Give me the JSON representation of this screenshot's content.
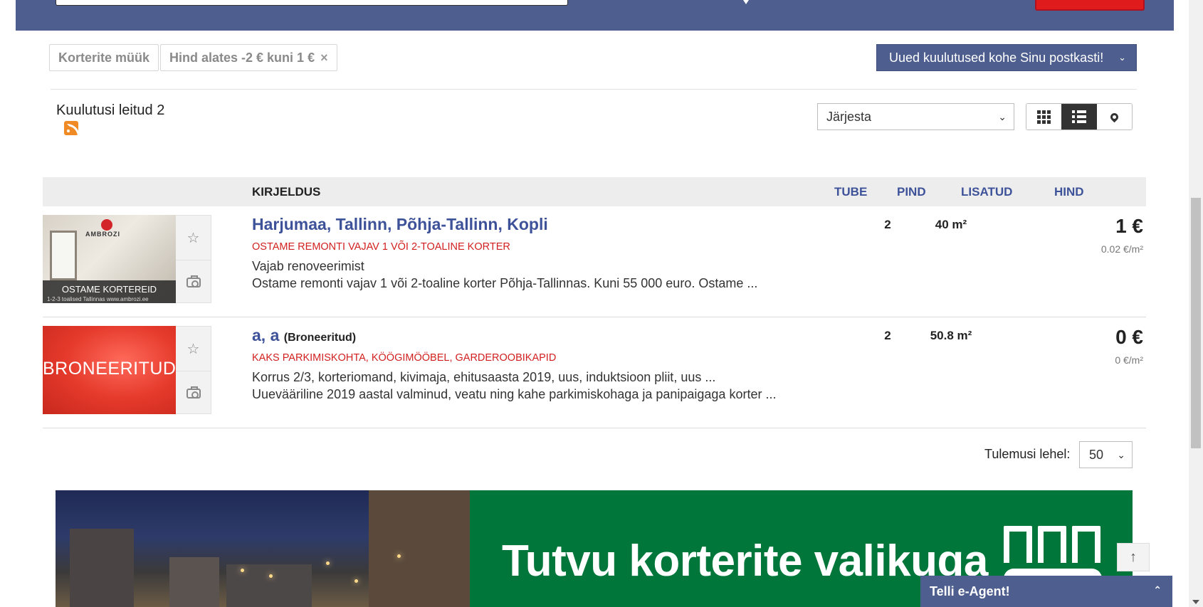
{
  "filters": {
    "chips": [
      {
        "label": "Korterite müük",
        "removable": false
      },
      {
        "label": "Hind alates -2 € kuni 1 €",
        "removable": true
      }
    ],
    "remove_icon": "×"
  },
  "email_alert": {
    "label": "Uued kuulutused kohe Sinu postkasti!",
    "chevron": "⌄"
  },
  "results": {
    "count_label": "Kuulutusi leitud 2",
    "sort": {
      "selected": "Järjesta"
    },
    "view_modes": [
      "grid-view-icon",
      "list-view-icon",
      "map-view-icon"
    ],
    "active_view": "list"
  },
  "table": {
    "headers": {
      "description": "KIRJELDUS",
      "rooms": "TUBE",
      "area": "PIND",
      "added": "LISATUD",
      "price": "HIND"
    }
  },
  "listings": [
    {
      "title": "Harjumaa, Tallinn, Põhja-Tallinn, Kopli",
      "status": "",
      "subtitle": "OSTAME REMONTI VAJAV 1 VÕI 2-TOALINE KORTER",
      "desc1": "Vajab renoveerimist",
      "desc2": "Ostame remonti vajav 1 või 2-toaline korter Põhja-Tallinnas. Kuni 55 000 euro. Ostame ...",
      "rooms": "2",
      "area": "40 m²",
      "added": "",
      "price": "1 €",
      "price_per_m2": "0.02 €/m²",
      "thumb_caption": "OSTAME KORTEREID",
      "thumb_small": "1-2-3 toalised Tallinnas     www.ambrozi.ee",
      "thumb_logo": "AMBROZI"
    },
    {
      "title": "a, a",
      "status": "(Broneeritud)",
      "subtitle": "KAKS PARKIMISKOHTA, KÖÖGIMÖÖBEL, GARDEROOBIKAPID",
      "desc1": "Korrus 2/3, korteriomand, kivimaja, ehitusaasta 2019, uus, induktsioon pliit, uus ...",
      "desc2": "Uuevääriline 2019 aastal valminud, veatu ning kahe parkimiskohaga ja panipaigaga korter ...",
      "rooms": "2",
      "area": "50.8 m²",
      "added": "",
      "price": "0 €",
      "price_per_m2": "0 €/m²",
      "thumb_caption": "BRONEERITUD"
    }
  ],
  "pagination": {
    "per_page_label": "Tulemusi lehel:",
    "per_page_value": "50"
  },
  "banner": {
    "text": "Tutvu korterite valikuga",
    "brand_color": "#00763a"
  },
  "back_to_top": "↑",
  "eagent": {
    "label": "Telli e-Agent!",
    "chevron": "⌃"
  },
  "colors": {
    "header": "#4e5f8f",
    "accent_red": "#d21f1f",
    "link_blue": "#3d5299"
  }
}
